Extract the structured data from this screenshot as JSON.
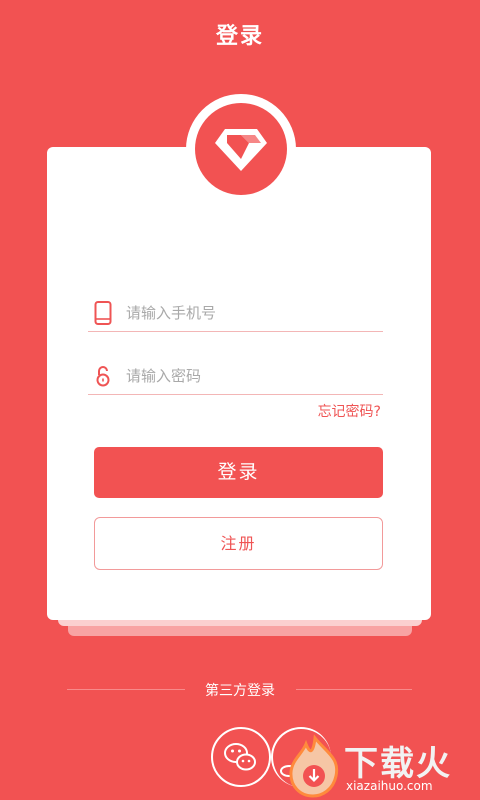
{
  "header": {
    "title": "登录"
  },
  "login_form": {
    "phone_placeholder": "请输入手机号",
    "password_placeholder": "请输入密码",
    "forgot_password": "忘记密码?",
    "login_button": "登录",
    "register_button": "注册"
  },
  "third_party": {
    "label": "第三方登录",
    "providers": [
      "wechat-icon",
      "weibo-icon"
    ]
  },
  "watermark": {
    "main": "下载火",
    "sub": "xiazaihuo.com"
  },
  "colors": {
    "brand": "#f25252",
    "field_line": "#f3b6b6",
    "white": "#ffffff"
  }
}
